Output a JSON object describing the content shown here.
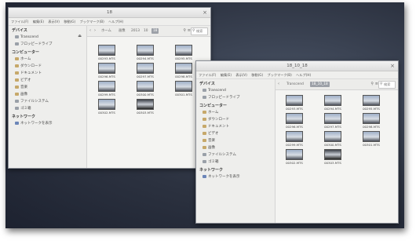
{
  "sidebar": {
    "devices_heading": "デバイス",
    "devices": [
      {
        "label": "Transcend",
        "icon": "drive-icon",
        "eject": "⏏"
      },
      {
        "label": "フロッピードライブ",
        "icon": "floppy-icon"
      }
    ],
    "computer_heading": "コンピューター",
    "computer": [
      {
        "label": "ホーム"
      },
      {
        "label": "ダウンロード"
      },
      {
        "label": "ドキュメント"
      },
      {
        "label": "ビデオ"
      },
      {
        "label": "音楽"
      },
      {
        "label": "画像"
      },
      {
        "label": "ファイルシステム"
      },
      {
        "label": "ゴミ箱"
      }
    ],
    "network_heading": "ネットワーク",
    "network": [
      {
        "label": "ネットワークを表示"
      }
    ]
  },
  "window1": {
    "title": "18",
    "menu": [
      "ファイル(F)",
      "編集(E)",
      "表示(V)",
      "移動(G)",
      "ブックマーク(B)",
      "ヘルプ(H)"
    ],
    "breadcrumbs": [
      "ホーム",
      "画像",
      "2013",
      "10",
      "18"
    ],
    "search_placeholder": "検索",
    "files": [
      "00293.MTS",
      "00294.MTS",
      "00295.MTS",
      "00296.MTS",
      "00297.MTS",
      "00298.MTS",
      "00299.MTS",
      "00300.MTS",
      "00301.MTS",
      "00302.MTS",
      "00303.MTS"
    ]
  },
  "window2": {
    "title": "18_10_18",
    "menu": [
      "ファイル(F)",
      "編集(E)",
      "表示(V)",
      "移動(G)",
      "ブックマーク(B)",
      "ヘルプ(H)"
    ],
    "breadcrumbs": [
      "Transcend",
      "18_10_18"
    ],
    "search_placeholder": "検索",
    "files": [
      "00293.MTS",
      "00294.MTS",
      "00295.MTS",
      "00296.MTS",
      "00297.MTS",
      "00298.MTS",
      "00299.MTS",
      "00300.MTS",
      "00301.MTS",
      "00302.MTS",
      "00303.MTS"
    ]
  }
}
